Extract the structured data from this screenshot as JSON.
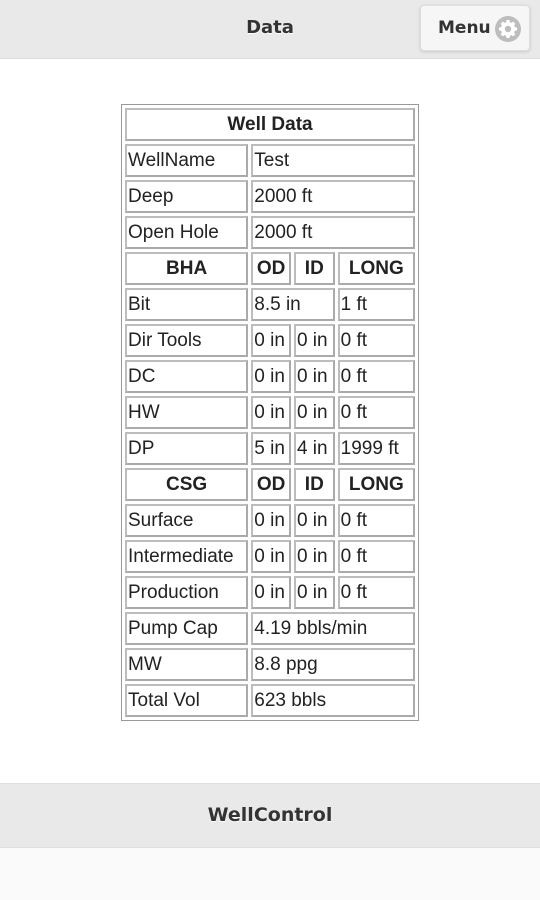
{
  "header": {
    "title": "Data",
    "menu_label": "Menu",
    "menu_icon": "gear-icon"
  },
  "table": {
    "title": "Well Data",
    "info_rows": [
      {
        "label": "WellName",
        "value": "Test"
      },
      {
        "label": "Deep",
        "value": "2000 ft"
      },
      {
        "label": "Open Hole",
        "value": "2000 ft"
      }
    ],
    "bha": {
      "headers": [
        "BHA",
        "OD",
        "ID",
        "LONG"
      ],
      "bit": {
        "label": "Bit",
        "size": "8.5 in",
        "long": "1 ft"
      },
      "rows": [
        {
          "label": "Dir Tools",
          "od": "0 in",
          "id": "0 in",
          "long": "0 ft"
        },
        {
          "label": "DC",
          "od": "0 in",
          "id": "0 in",
          "long": "0 ft"
        },
        {
          "label": "HW",
          "od": "0 in",
          "id": "0 in",
          "long": "0 ft"
        },
        {
          "label": "DP",
          "od": "5 in",
          "id": "4 in",
          "long": "1999 ft"
        }
      ]
    },
    "csg": {
      "headers": [
        "CSG",
        "OD",
        "ID",
        "LONG"
      ],
      "rows": [
        {
          "label": "Surface",
          "od": "0 in",
          "id": "0 in",
          "long": "0 ft"
        },
        {
          "label": "Intermediate",
          "od": "0 in",
          "id": "0 in",
          "long": "0 ft"
        },
        {
          "label": "Production",
          "od": "0 in",
          "id": "0 in",
          "long": "0 ft"
        }
      ]
    },
    "summary_rows": [
      {
        "label": "Pump Cap",
        "value": "4.19 bbls/min"
      },
      {
        "label": "MW",
        "value": "8.8 ppg"
      },
      {
        "label": "Total Vol",
        "value": "623 bbls"
      }
    ]
  },
  "footer": {
    "well_control_label": "WellControl"
  }
}
